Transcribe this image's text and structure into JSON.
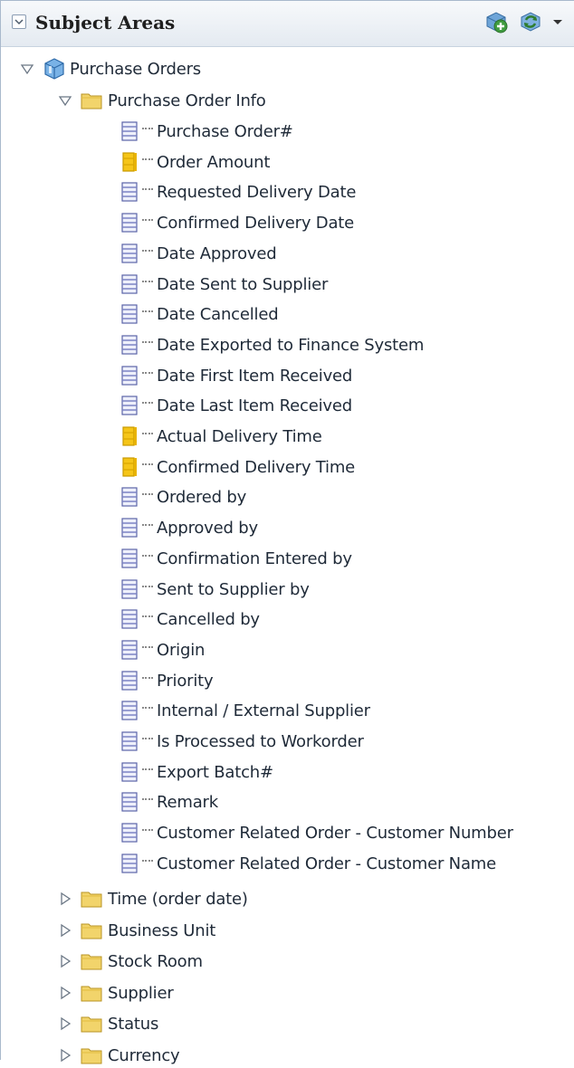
{
  "panel": {
    "title": "Subject Areas",
    "toolbar": {
      "collapse_icon": "chevron-down-icon",
      "add_icon": "add-subject-area-icon",
      "refresh_icon": "refresh-icon",
      "menu_icon": "dropdown-arrow-icon"
    }
  },
  "tree": {
    "root": {
      "label": "Purchase Orders",
      "expanded": true,
      "icon": "subject-area-icon"
    },
    "open_folder": {
      "label": "Purchase Order Info",
      "expanded": true,
      "icon": "folder-icon"
    },
    "columns": [
      {
        "label": "Purchase Order#",
        "kind": "attribute"
      },
      {
        "label": "Order Amount",
        "kind": "measure"
      },
      {
        "label": "Requested Delivery Date",
        "kind": "attribute"
      },
      {
        "label": "Confirmed Delivery Date",
        "kind": "attribute"
      },
      {
        "label": "Date Approved",
        "kind": "attribute"
      },
      {
        "label": "Date Sent to Supplier",
        "kind": "attribute"
      },
      {
        "label": "Date Cancelled",
        "kind": "attribute"
      },
      {
        "label": "Date Exported to Finance System",
        "kind": "attribute"
      },
      {
        "label": "Date First Item Received",
        "kind": "attribute"
      },
      {
        "label": "Date Last Item Received",
        "kind": "attribute"
      },
      {
        "label": "Actual Delivery Time",
        "kind": "measure"
      },
      {
        "label": "Confirmed Delivery Time",
        "kind": "measure"
      },
      {
        "label": "Ordered by",
        "kind": "attribute"
      },
      {
        "label": "Approved by",
        "kind": "attribute"
      },
      {
        "label": "Confirmation Entered by",
        "kind": "attribute"
      },
      {
        "label": "Sent to Supplier by",
        "kind": "attribute"
      },
      {
        "label": "Cancelled by",
        "kind": "attribute"
      },
      {
        "label": "Origin",
        "kind": "attribute"
      },
      {
        "label": "Priority",
        "kind": "attribute"
      },
      {
        "label": "Internal / External Supplier",
        "kind": "attribute"
      },
      {
        "label": "Is Processed to Workorder",
        "kind": "attribute"
      },
      {
        "label": "Export Batch#",
        "kind": "attribute"
      },
      {
        "label": "Remark",
        "kind": "attribute"
      },
      {
        "label": "Customer Related Order - Customer Number",
        "kind": "attribute"
      },
      {
        "label": "Customer Related Order - Customer Name",
        "kind": "attribute"
      }
    ],
    "folders": [
      {
        "label": "Time (order date)",
        "expanded": false
      },
      {
        "label": "Business Unit",
        "expanded": false
      },
      {
        "label": "Stock Room",
        "expanded": false
      },
      {
        "label": "Supplier",
        "expanded": false
      },
      {
        "label": "Status",
        "expanded": false
      },
      {
        "label": "Currency",
        "expanded": false
      }
    ]
  },
  "colors": {
    "header_top": "#f7f9fb",
    "header_bottom": "#e4eaf1",
    "folder": "#f2d46b",
    "attribute": "#8b90c9",
    "measure": "#f0c419",
    "text": "#1f2a38"
  }
}
